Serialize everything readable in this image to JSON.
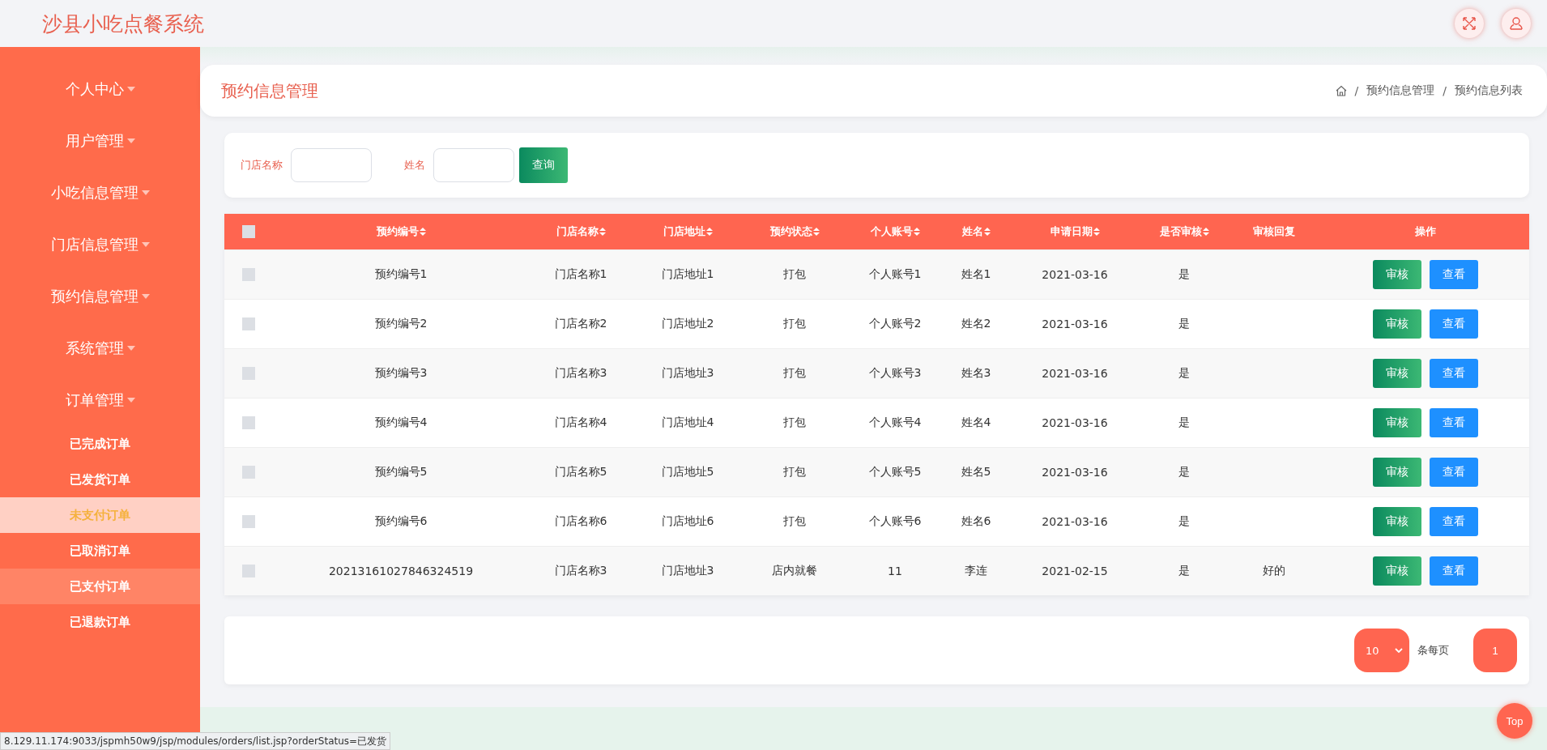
{
  "header": {
    "title": "沙县小吃点餐系统"
  },
  "sidebar": {
    "items": [
      {
        "label": "个人中心"
      },
      {
        "label": "用户管理"
      },
      {
        "label": "小吃信息管理"
      },
      {
        "label": "门店信息管理"
      },
      {
        "label": "预约信息管理"
      },
      {
        "label": "系统管理"
      },
      {
        "label": "订单管理",
        "children": [
          {
            "label": "已完成订单",
            "selected": false,
            "hovered": false
          },
          {
            "label": "已发货订单",
            "selected": false,
            "hovered": false
          },
          {
            "label": "未支付订单",
            "selected": true,
            "hovered": false
          },
          {
            "label": "已取消订单",
            "selected": false,
            "hovered": false
          },
          {
            "label": "已支付订单",
            "selected": false,
            "hovered": true
          },
          {
            "label": "已退款订单",
            "selected": false,
            "hovered": false
          }
        ]
      }
    ]
  },
  "page_title": "预约信息管理",
  "breadcrumb": [
    {
      "separator": "/",
      "label": "预约信息管理"
    },
    {
      "separator": "/",
      "label": "预约信息列表"
    }
  ],
  "search": {
    "fields": [
      {
        "label": "门店名称"
      },
      {
        "label": "姓名"
      }
    ],
    "button": "查询"
  },
  "table": {
    "columns": [
      {
        "label": "预约编号",
        "sortable": true
      },
      {
        "label": "门店名称",
        "sortable": true
      },
      {
        "label": "门店地址",
        "sortable": true
      },
      {
        "label": "预约状态",
        "sortable": true
      },
      {
        "label": "个人账号",
        "sortable": true
      },
      {
        "label": "姓名",
        "sortable": true
      },
      {
        "label": "申请日期",
        "sortable": true
      },
      {
        "label": "是否审核",
        "sortable": true
      },
      {
        "label": "审核回复",
        "sortable": false
      },
      {
        "label": "操作",
        "sortable": false
      }
    ],
    "header_checked": false,
    "rows": [
      {
        "checked": false,
        "cells": [
          "预约编号1",
          "门店名称1",
          "门店地址1",
          "打包",
          "个人账号1",
          "姓名1",
          "2021-03-16",
          "是",
          ""
        ],
        "actions": [
          {
            "label": "审核",
            "kind": "review"
          },
          {
            "label": "查看",
            "kind": "view"
          }
        ]
      },
      {
        "checked": false,
        "cells": [
          "预约编号2",
          "门店名称2",
          "门店地址2",
          "打包",
          "个人账号2",
          "姓名2",
          "2021-03-16",
          "是",
          ""
        ],
        "actions": [
          {
            "label": "审核",
            "kind": "review"
          },
          {
            "label": "查看",
            "kind": "view"
          }
        ]
      },
      {
        "checked": false,
        "cells": [
          "预约编号3",
          "门店名称3",
          "门店地址3",
          "打包",
          "个人账号3",
          "姓名3",
          "2021-03-16",
          "是",
          ""
        ],
        "actions": [
          {
            "label": "审核",
            "kind": "review"
          },
          {
            "label": "查看",
            "kind": "view"
          }
        ]
      },
      {
        "checked": false,
        "cells": [
          "预约编号4",
          "门店名称4",
          "门店地址4",
          "打包",
          "个人账号4",
          "姓名4",
          "2021-03-16",
          "是",
          ""
        ],
        "actions": [
          {
            "label": "审核",
            "kind": "review"
          },
          {
            "label": "查看",
            "kind": "view"
          }
        ]
      },
      {
        "checked": false,
        "cells": [
          "预约编号5",
          "门店名称5",
          "门店地址5",
          "打包",
          "个人账号5",
          "姓名5",
          "2021-03-16",
          "是",
          ""
        ],
        "actions": [
          {
            "label": "审核",
            "kind": "review"
          },
          {
            "label": "查看",
            "kind": "view"
          }
        ]
      },
      {
        "checked": false,
        "cells": [
          "预约编号6",
          "门店名称6",
          "门店地址6",
          "打包",
          "个人账号6",
          "姓名6",
          "2021-03-16",
          "是",
          ""
        ],
        "actions": [
          {
            "label": "审核",
            "kind": "review"
          },
          {
            "label": "查看",
            "kind": "view"
          }
        ]
      },
      {
        "checked": false,
        "cells": [
          "20213161027846324519",
          "门店名称3",
          "门店地址3",
          "店内就餐",
          "11",
          "李连",
          "2021-02-15",
          "是",
          "好的"
        ],
        "actions": [
          {
            "label": "审核",
            "kind": "review"
          },
          {
            "label": "查看",
            "kind": "view"
          }
        ]
      }
    ]
  },
  "pagination": {
    "page_size": "10",
    "page_size_label": "条每页",
    "pages": [
      {
        "label": "1",
        "selected": true
      }
    ]
  },
  "top_button": "Top",
  "status_bar": "8.129.11.174:9033/jspmh50w9/jsp/modules/orders/list.jsp?orderStatus=已发货"
}
